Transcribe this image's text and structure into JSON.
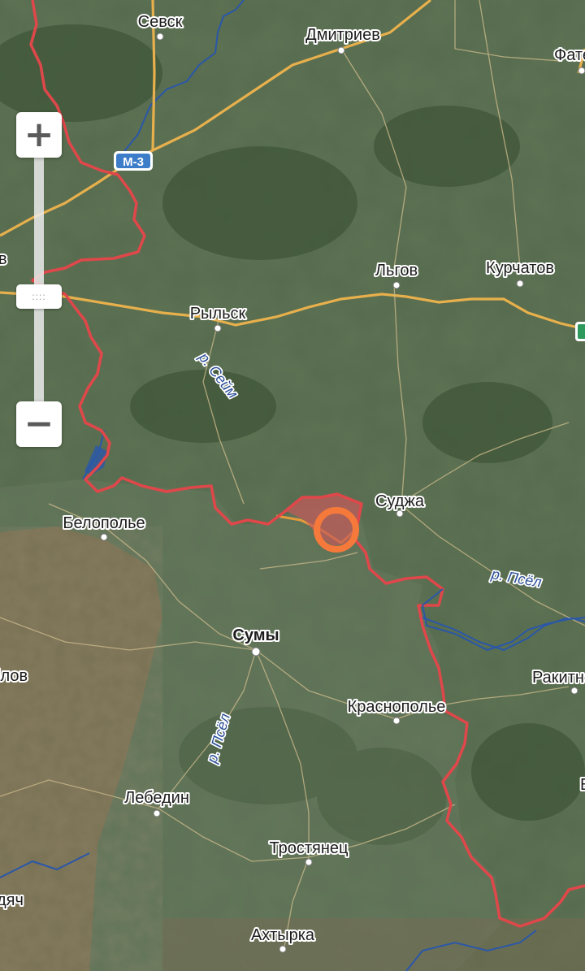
{
  "map": {
    "cities": [
      "Севск",
      "Дмитриев",
      "Фатеж",
      "Льгов",
      "Курчатов",
      "Рыльск",
      "Суджа",
      "Белополье",
      "Сумы",
      "Ракитное",
      "Краснополье",
      "Лебедин",
      "Тростянец",
      "Ахтырка"
    ],
    "cut_labels": {
      "b": "в",
      "ilov": "ілов",
      "dyach": "дяч",
      "e": "Е"
    },
    "rivers": {
      "seym": "р. Сейм",
      "psel_east": "р. Псёл",
      "psel_south": "р. Псёл"
    },
    "road_badge": "М-3"
  },
  "colors": {
    "border": "#e0474a",
    "road": "#e7b04d",
    "highlight_ring": "#f5793a",
    "occupied_fill": "#c85a5a",
    "water_line": "#2a57a8"
  },
  "controls": {
    "zoom_in_symbol": "+",
    "zoom_out_symbol": "−",
    "slider_grip": "::::"
  }
}
